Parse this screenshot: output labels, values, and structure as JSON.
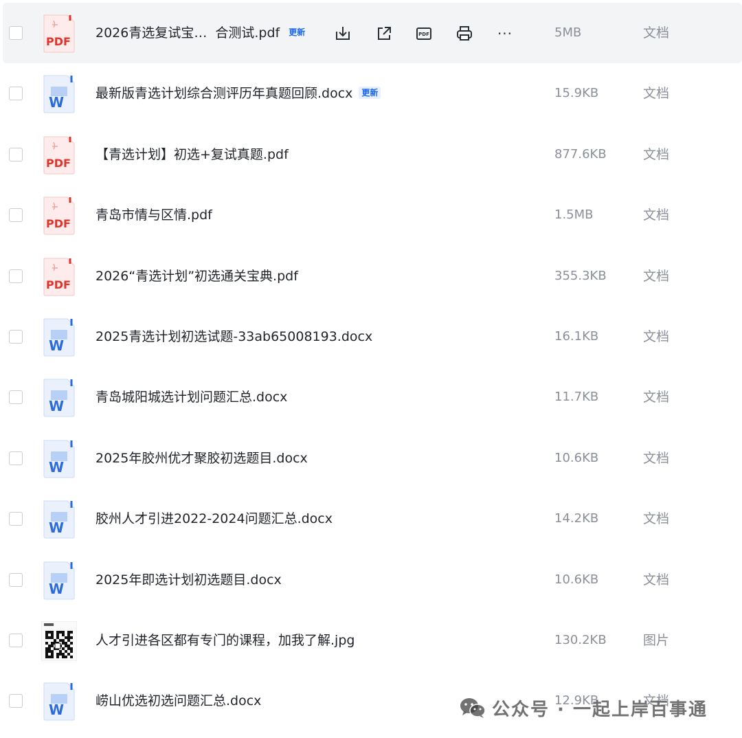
{
  "files": [
    {
      "name": "2026青选复试宝…",
      "name_tail": "合测试.pdf",
      "badge": "更新",
      "size": "5MB",
      "type": "文档",
      "icon": "pdf-icon",
      "hover": true
    },
    {
      "name": "最新版青选计划综合测评历年真题回顾.docx",
      "badge": "更新",
      "size": "15.9KB",
      "type": "文档",
      "icon": "word-icon"
    },
    {
      "name": "【青选计划】初选+复试真题.pdf",
      "size": "877.6KB",
      "type": "文档",
      "icon": "pdf-icon"
    },
    {
      "name": "青岛市情与区情.pdf",
      "size": "1.5MB",
      "type": "文档",
      "icon": "pdf-icon"
    },
    {
      "name": "2026“青选计划”初选通关宝典.pdf",
      "size": "355.3KB",
      "type": "文档",
      "icon": "pdf-icon"
    },
    {
      "name": "2025青选计划初选试题-33ab65008193.docx",
      "size": "16.1KB",
      "type": "文档",
      "icon": "word-icon"
    },
    {
      "name": "青岛城阳城选计划问题汇总.docx",
      "size": "11.7KB",
      "type": "文档",
      "icon": "word-icon"
    },
    {
      "name": "2025年胶州优才聚胶初选题目.docx",
      "size": "10.6KB",
      "type": "文档",
      "icon": "word-icon"
    },
    {
      "name": "胶州人才引进2022-2024问题汇总.docx",
      "size": "14.2KB",
      "type": "文档",
      "icon": "word-icon"
    },
    {
      "name": "2025年即选计划初选题目.docx",
      "size": "10.6KB",
      "type": "文档",
      "icon": "word-icon"
    },
    {
      "name": "人才引进各区都有专门的课程，加我了解.jpg",
      "size": "130.2KB",
      "type": "图片",
      "icon": "qr-image-thumbnail"
    },
    {
      "name": "崂山优选初选问题汇总.docx",
      "size": "12.9KB",
      "type": "文档",
      "icon": "word-icon"
    }
  ],
  "row_actions": [
    {
      "name": "download-icon"
    },
    {
      "name": "share-icon"
    },
    {
      "name": "pdf-convert-icon"
    },
    {
      "name": "print-icon"
    },
    {
      "name": "more-icon",
      "label": "···"
    }
  ],
  "icon_labels": {
    "pdf": "PDF",
    "word": "W"
  },
  "watermark": {
    "text": "公众号 · 一起上岸百事通",
    "icon": "wechat-icon"
  },
  "colors": {
    "pdf_red": "#e0352b",
    "word_blue": "#2b6bde",
    "badge_blue": "#1966ff",
    "hover_bg": "#f3f4f5"
  }
}
